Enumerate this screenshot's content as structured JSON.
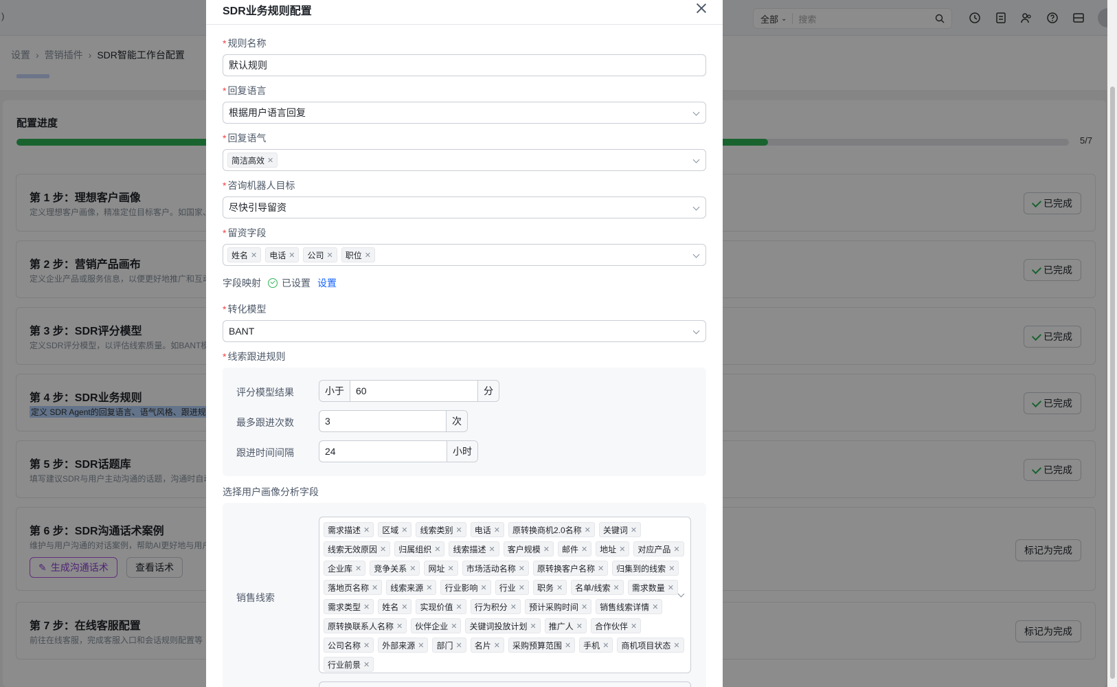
{
  "topbar": {
    "left_text": ")",
    "search_scope": "全部",
    "search_placeholder": "搜索"
  },
  "breadcrumb": {
    "items": [
      "设置",
      "营销插件",
      "SDR智能工作台配置"
    ]
  },
  "progress": {
    "title": "配置进度",
    "value_fraction": 0.714,
    "text": "5/7"
  },
  "steps": [
    {
      "title": "第 1 步：理想客户画像",
      "desc": "定义理想客户画像，精准定位目标客户。如国家、",
      "status": "已完成"
    },
    {
      "title": "第 2 步：营销产品画布",
      "desc": "定义企业产品或服务信息，以便更好地推广和互动",
      "status": "已完成"
    },
    {
      "title": "第 3 步：SDR评分模型",
      "desc": "定义SDR评分模型，以评估线索质量。如BANT模",
      "status": "已完成"
    },
    {
      "title": "第 4 步：SDR业务规则",
      "desc": "定义 SDR Agent的回复语言、语气风格、跟进规",
      "status": "已完成"
    },
    {
      "title": "第 5 步：SDR话题库",
      "desc": "填写建议SDR与用户主动沟通的话题，沟通时自动",
      "status": "已完成"
    },
    {
      "title": "第 6 步：SDR沟通话术案例",
      "desc": "维护与用户沟通的对话案例，帮助AI更好地与用户",
      "status": "标记为完成",
      "btn_generate": "生成沟通话术",
      "btn_view": "查看话术"
    },
    {
      "title": "第 7 步：在线客服配置",
      "desc": "前往在线客服，完成客服入口和会话规则配置等",
      "status": "标记为完成"
    }
  ],
  "modal": {
    "title": "SDR业务规则配置",
    "rule_name": {
      "label": "规则名称",
      "value": "默认规则"
    },
    "reply_language": {
      "label": "回复语言",
      "value": "根据用户语言回复"
    },
    "reply_tone": {
      "label": "回复语气",
      "tags": [
        "简洁高效"
      ]
    },
    "bot_goal": {
      "label": "咨询机器人目标",
      "value": "尽快引导留资"
    },
    "lead_fields": {
      "label": "留资字段",
      "tags": [
        "姓名",
        "电话",
        "公司",
        "职位"
      ]
    },
    "field_mapping": {
      "label": "字段映射",
      "status": "已设置",
      "action": "设置"
    },
    "conversion_model": {
      "label": "转化模型",
      "value": "BANT"
    },
    "followup": {
      "label": "线索跟进规则",
      "score_label": "评分模型结果",
      "score_op": "小于",
      "score_value": "60",
      "score_unit": "分",
      "max_label": "最多跟进次数",
      "max_value": "3",
      "max_unit": "次",
      "interval_label": "跟进时间间隔",
      "interval_value": "24",
      "interval_unit": "小时"
    },
    "persona_fields": {
      "label": "选择用户画像分析字段",
      "row_label": "销售线索",
      "tag_lines": [
        [
          "需求描述",
          "区域",
          "线索类别",
          "电话",
          "原转换商机2.0名称",
          "关键词"
        ],
        [
          "线索无效原因",
          "归属组织",
          "线索描述",
          "客户规模",
          "邮件",
          "地址",
          "对应产品"
        ],
        [
          "企业库",
          "竞争关系",
          "网址",
          "市场活动名称",
          "原转换客户名称",
          "归集到的线索"
        ],
        [
          "落地页名称",
          "线索来源",
          "行业影响",
          "行业",
          "职务",
          "名单/线索",
          "需求数量"
        ],
        [
          "需求类型",
          "姓名",
          "实现价值",
          "行为积分",
          "预计采购时间",
          "销售线索详情"
        ],
        [
          "原转换联系人名称",
          "伙伴企业",
          "关键词投放计划",
          "推广人",
          "合作伙伴"
        ],
        [
          "公司名称",
          "外部来源",
          "部门",
          "名片",
          "采购预算范围",
          "手机",
          "商机项目状态"
        ],
        [
          "行业前景"
        ]
      ]
    }
  }
}
